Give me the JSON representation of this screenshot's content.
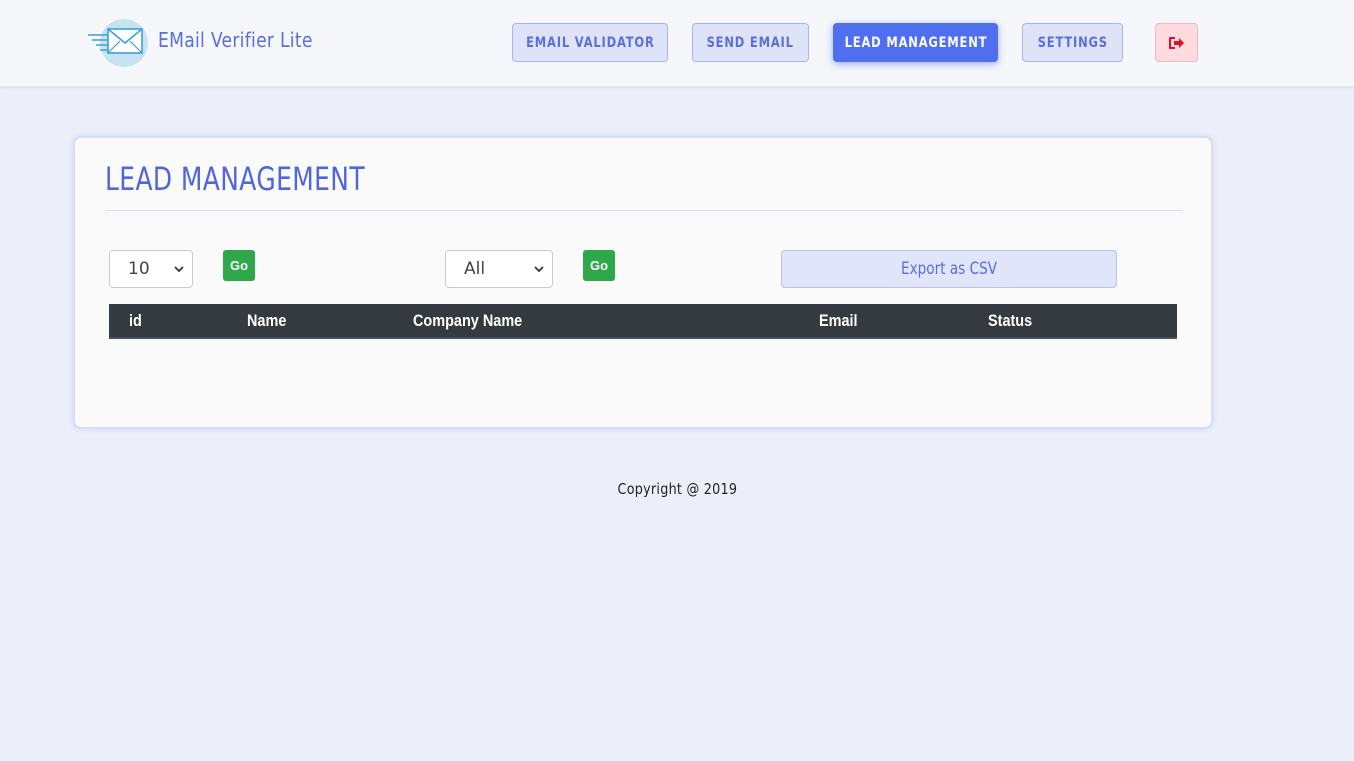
{
  "app": {
    "title": "EMail Verifier Lite",
    "logo_icon": "envelope-icon"
  },
  "nav": {
    "items": [
      {
        "label": "EMAIL VALIDATOR",
        "active": false
      },
      {
        "label": "SEND EMAIL",
        "active": false
      },
      {
        "label": "LEAD MANAGEMENT",
        "active": true
      },
      {
        "label": "SETTINGS",
        "active": false
      }
    ],
    "logout_icon": "sign-out-icon"
  },
  "page": {
    "title": "LEAD MANAGEMENT"
  },
  "controls": {
    "page_size_value": "10",
    "go_label_1": "Go",
    "status_filter_value": "All",
    "go_label_2": "Go",
    "export_label": "Export as CSV"
  },
  "table": {
    "columns": [
      "id",
      "Name",
      "Company Name",
      "Email",
      "Status"
    ],
    "rows": []
  },
  "footer": {
    "copyright": "Copyright @ 2019"
  },
  "colors": {
    "accent": "#4f6ef0",
    "go_green": "#2ea84a",
    "logout_red": "#e0102a",
    "table_header": "#343a40"
  }
}
